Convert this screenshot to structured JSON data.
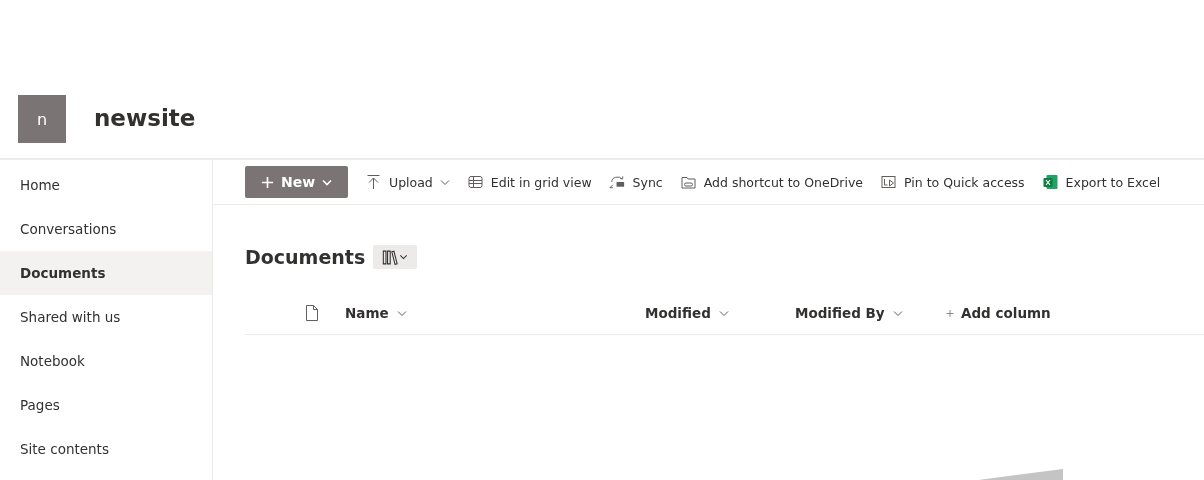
{
  "site": {
    "logo_letter": "n",
    "title": "newsite"
  },
  "nav": [
    {
      "label": "Home",
      "selected": false
    },
    {
      "label": "Conversations",
      "selected": false
    },
    {
      "label": "Documents",
      "selected": true
    },
    {
      "label": "Shared with us",
      "selected": false
    },
    {
      "label": "Notebook",
      "selected": false
    },
    {
      "label": "Pages",
      "selected": false
    },
    {
      "label": "Site contents",
      "selected": false
    }
  ],
  "commands": [
    {
      "label": "New",
      "kind": "primary"
    },
    {
      "label": "Upload",
      "kind": "upload"
    },
    {
      "label": "Edit in grid view",
      "kind": "grid"
    },
    {
      "label": "Sync",
      "kind": "sync"
    },
    {
      "label": "Add shortcut to OneDrive",
      "kind": "shortcut"
    },
    {
      "label": "Pin to Quick access",
      "kind": "pin"
    },
    {
      "label": "Export to Excel",
      "kind": "excel"
    }
  ],
  "library": {
    "title": "Documents"
  },
  "columns": [
    {
      "label": "Name",
      "kind": "sort"
    },
    {
      "label": "Modified",
      "kind": "sort"
    },
    {
      "label": "Modified By",
      "kind": "sort"
    },
    {
      "label": "Add column",
      "kind": "add"
    }
  ]
}
